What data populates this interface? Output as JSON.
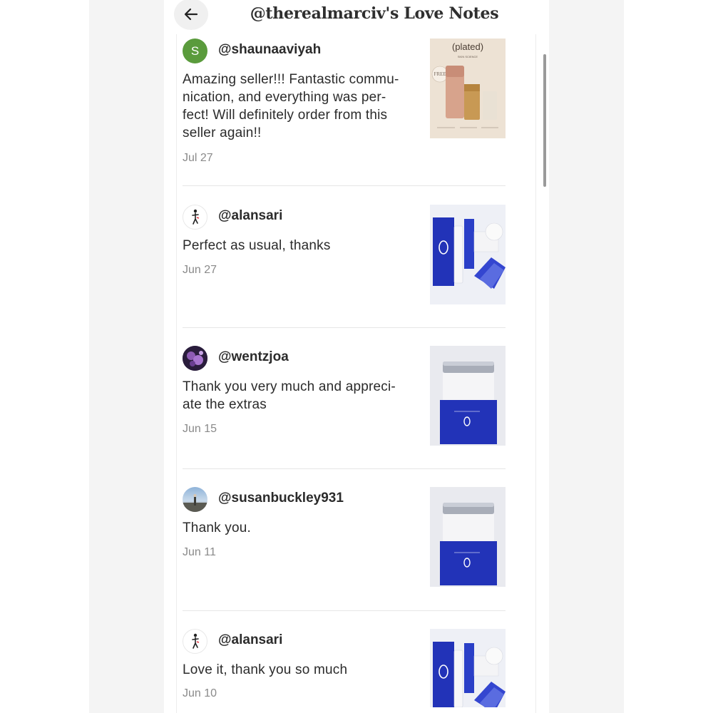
{
  "header": {
    "title": "@therealmarciv's Love Notes"
  },
  "notes": [
    {
      "username": "@shaunaaviyah",
      "avatar_letter": "S",
      "text": "Amazing seller!!! Fantastic commu-\nnication, and everything was per-\nfect! Will definitely order from this\nseller again!!",
      "date": "Jul 27",
      "thumb_brand": "(plated)",
      "thumb_sub": "SKIN SCIENCE",
      "thumb_badge": "FREE"
    },
    {
      "username": "@alansari",
      "text": "Perfect as usual, thanks",
      "date": "Jun 27"
    },
    {
      "username": "@wentzjoa",
      "text": "Thank you very much and appreci-\nate the extras",
      "date": "Jun 15"
    },
    {
      "username": "@susanbuckley931",
      "text": "Thank you.",
      "date": "Jun 11"
    },
    {
      "username": "@alansari",
      "text": "Love it, thank you so much",
      "date": "Jun 10"
    }
  ],
  "icons": {
    "back": "arrow-left-icon"
  },
  "colors": {
    "avatar_green": "#5a9b3c",
    "product_blue": "#2233b8",
    "text": "#2b2b2b",
    "muted": "#8a8a8a"
  }
}
